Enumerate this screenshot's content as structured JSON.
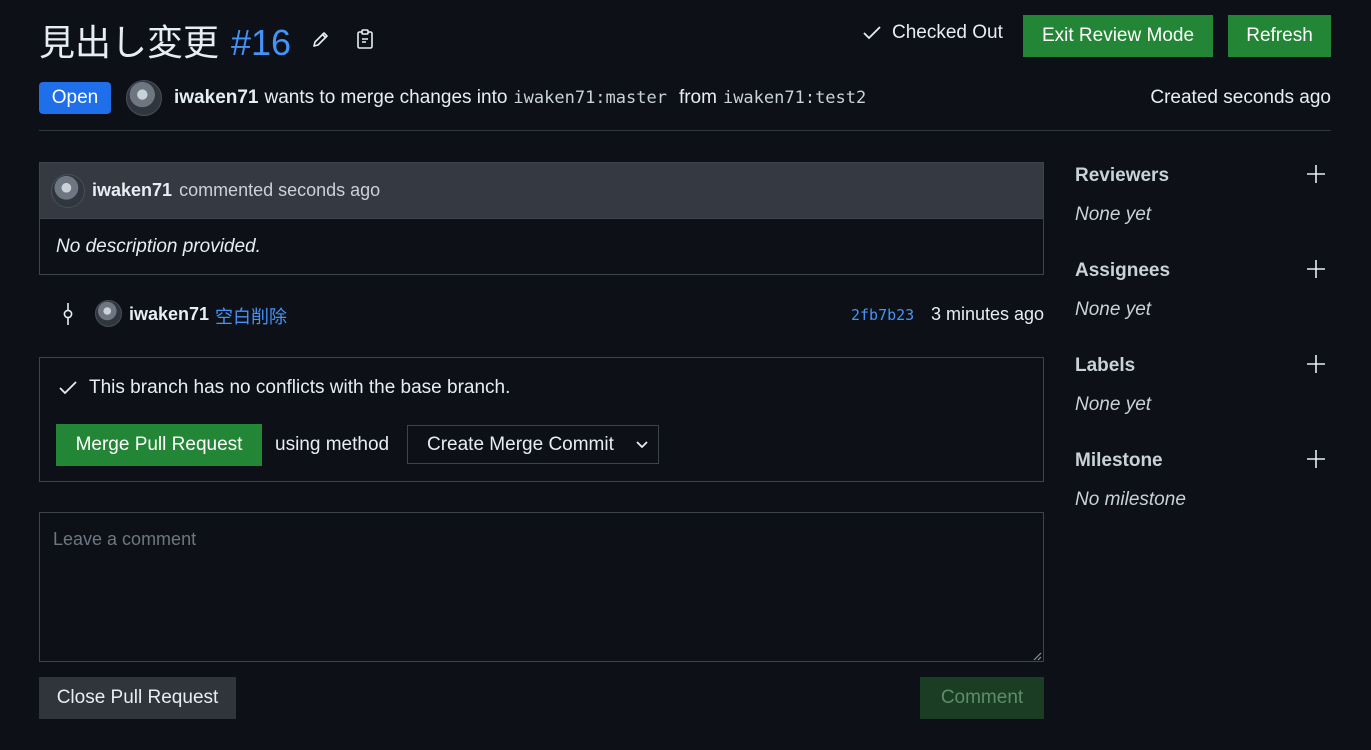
{
  "header": {
    "title": "見出し変更",
    "number": "#16",
    "checked_out_label": "Checked Out",
    "exit_review_label": "Exit Review Mode",
    "refresh_label": "Refresh"
  },
  "meta": {
    "status": "Open",
    "author": "iwaken71",
    "wants_to_merge": "wants to merge changes into",
    "base_branch": "iwaken71:master",
    "from_word": "from",
    "head_branch": "iwaken71:test2",
    "created": "Created seconds ago"
  },
  "comment": {
    "author": "iwaken71",
    "action": "commented seconds ago",
    "body": "No description provided."
  },
  "commit": {
    "author": "iwaken71",
    "message": "空白削除",
    "hash": "2fb7b23",
    "time": "3 minutes ago"
  },
  "merge": {
    "status_text": "This branch has no conflicts with the base branch.",
    "merge_button": "Merge Pull Request",
    "using_method": "using method",
    "method_selected": "Create Merge Commit"
  },
  "new_comment": {
    "placeholder": "Leave a comment",
    "close_button": "Close Pull Request",
    "comment_button": "Comment"
  },
  "sidebar": {
    "reviewers": {
      "label": "Reviewers",
      "value": "None yet"
    },
    "assignees": {
      "label": "Assignees",
      "value": "None yet"
    },
    "labels": {
      "label": "Labels",
      "value": "None yet"
    },
    "milestone": {
      "label": "Milestone",
      "value": "No milestone"
    }
  },
  "colors": {
    "background": "#0d1117",
    "accent_blue": "#4493f8",
    "button_green": "#238636",
    "open_badge": "#1f6feb"
  },
  "icons": [
    "edit-icon",
    "copy-icon",
    "check-icon",
    "commit-icon",
    "chevron-down-icon",
    "plus-icon"
  ]
}
